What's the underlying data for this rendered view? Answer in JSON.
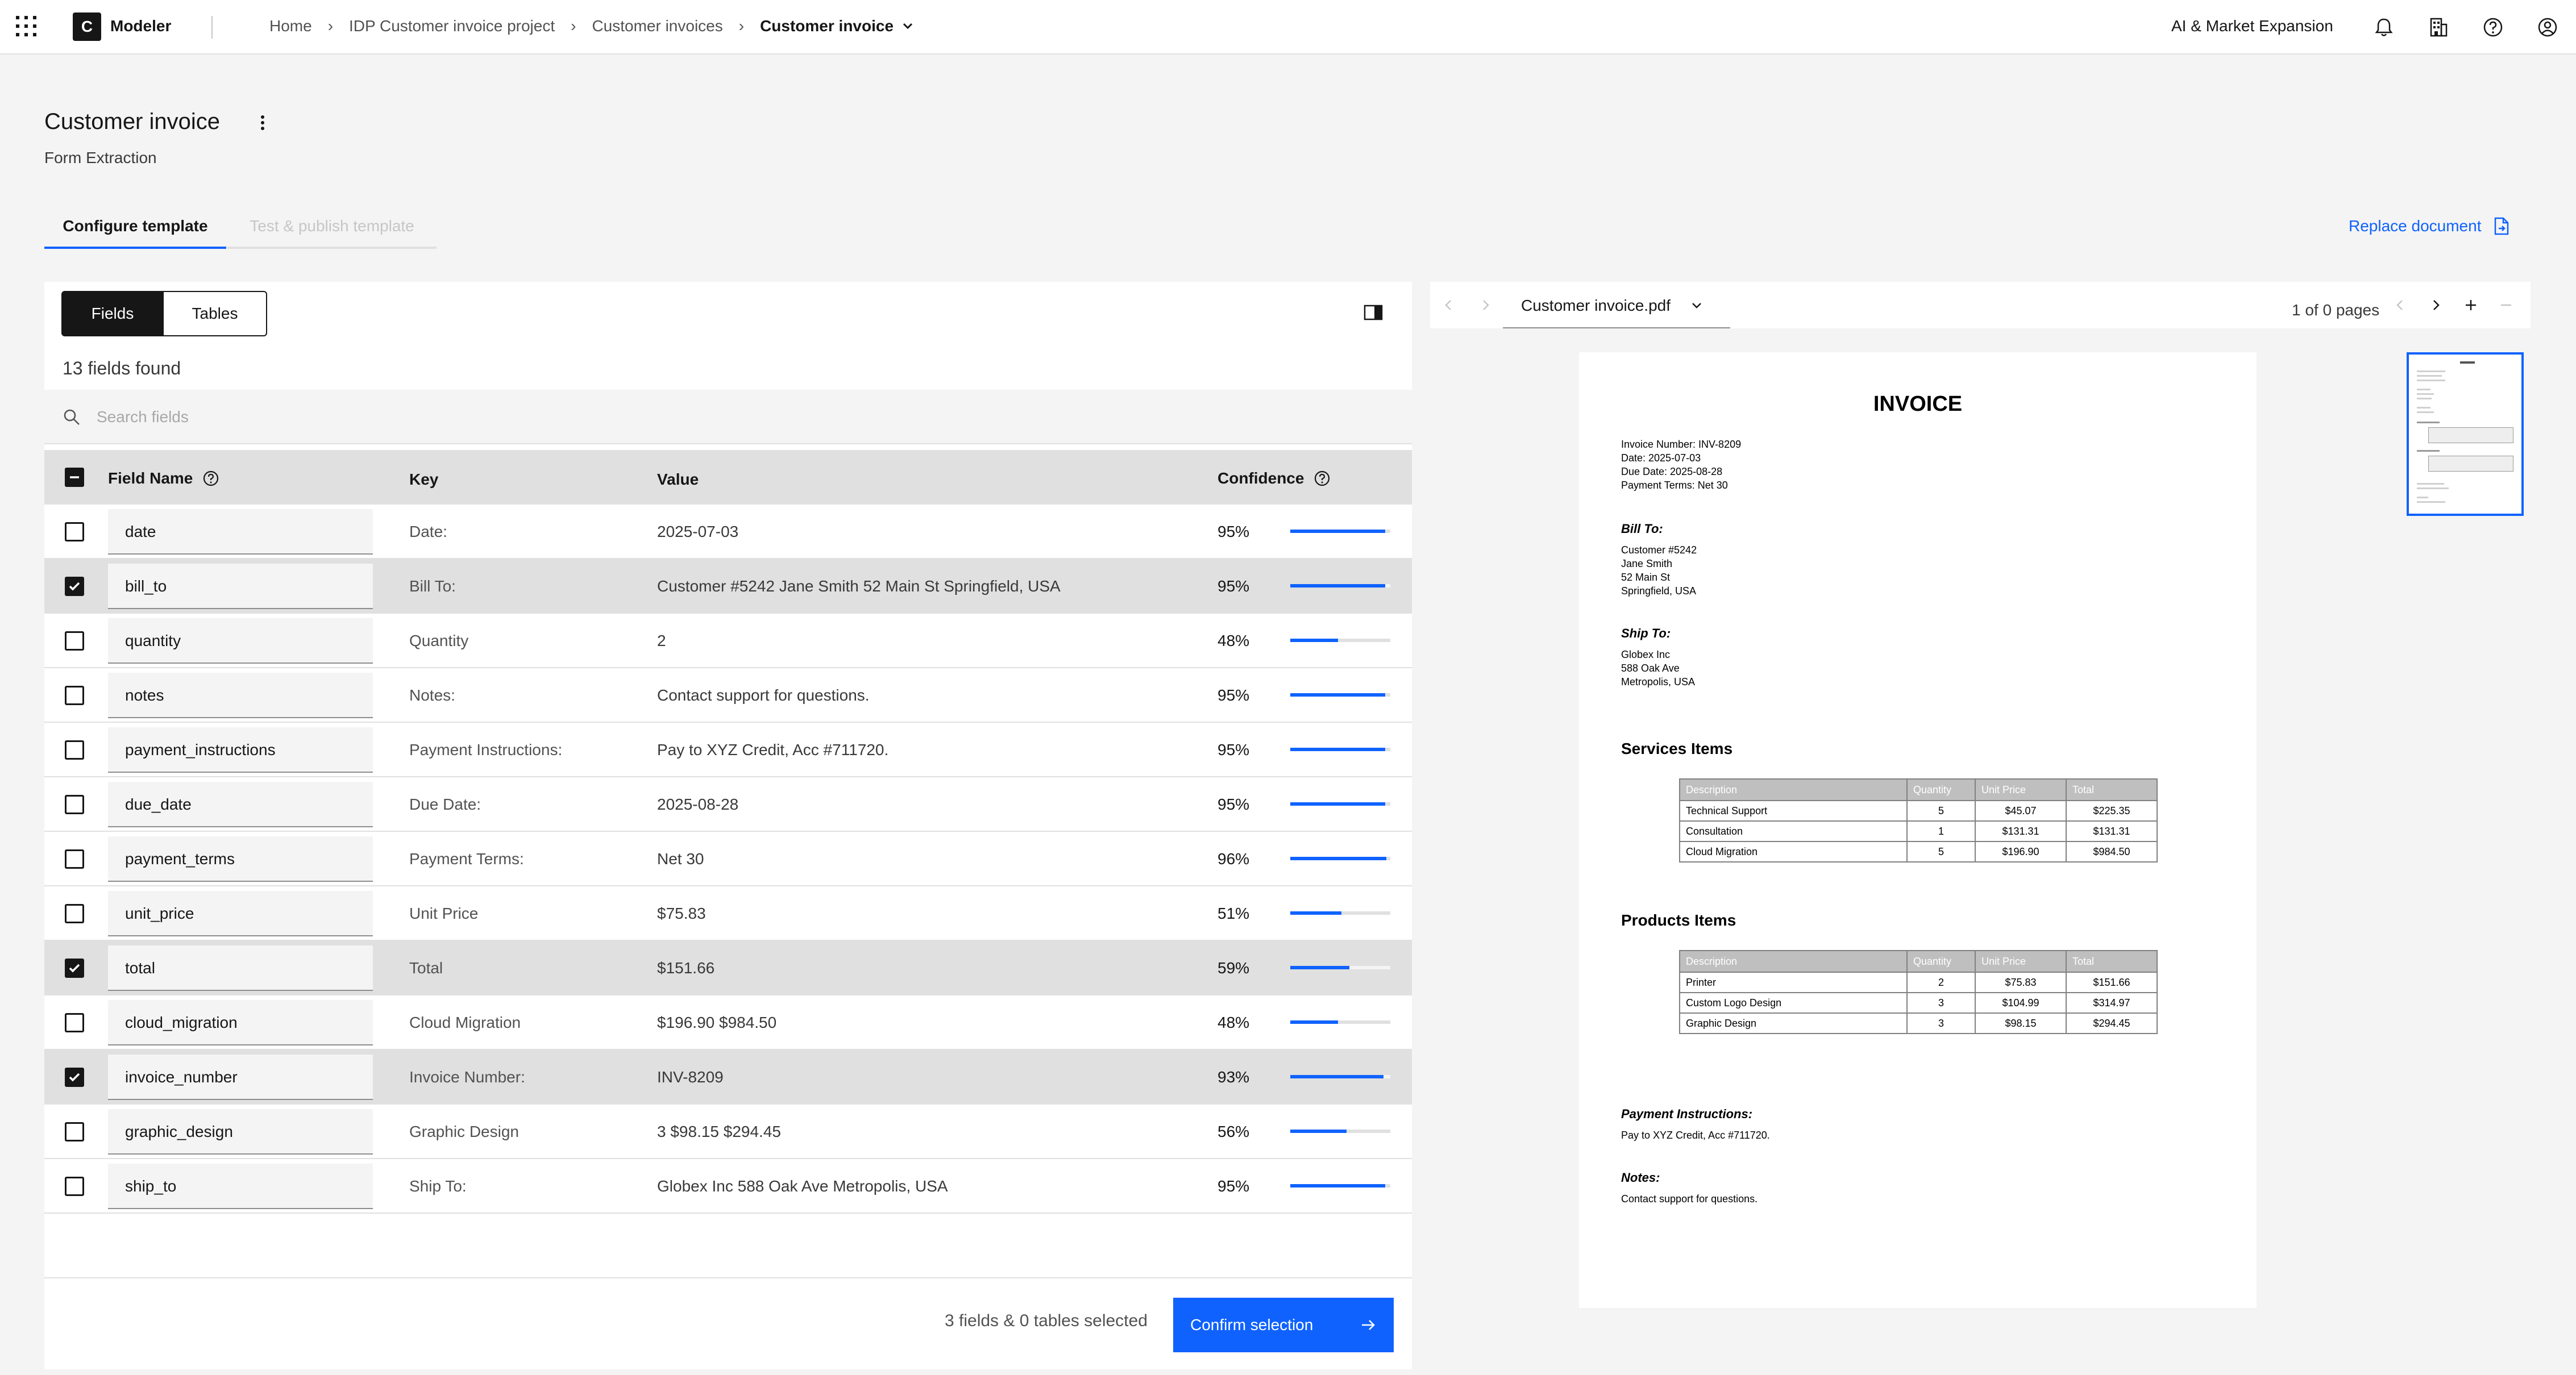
{
  "header": {
    "logo_letter": "C",
    "app_name": "Modeler",
    "breadcrumb": [
      "Home",
      "IDP Customer invoice project",
      "Customer invoices"
    ],
    "breadcrumb_current": "Customer invoice",
    "org_name": "AI & Market Expansion",
    "icons": [
      "app-switcher-icon",
      "notification-icon",
      "building-icon",
      "help-icon",
      "user-avatar-icon"
    ]
  },
  "page": {
    "title": "Customer invoice",
    "subtitle": "Form Extraction",
    "tabs": [
      "Configure template",
      "Test & publish template"
    ],
    "active_tab": 0,
    "replace_document": "Replace document"
  },
  "fields_panel": {
    "segments": [
      "Fields",
      "Tables"
    ],
    "active_segment": 0,
    "fields_found": "13 fields found",
    "search_placeholder": "Search fields",
    "columns": {
      "field_name": "Field Name",
      "key": "Key",
      "value": "Value",
      "confidence": "Confidence"
    },
    "rows": [
      {
        "name": "date",
        "key": "Date:",
        "value": "2025-07-03",
        "confidence": "95%",
        "conf_value": 0.95,
        "checked": false
      },
      {
        "name": "bill_to",
        "key": "Bill To:",
        "value": "Customer #5242 Jane Smith 52 Main St Springfield, USA",
        "confidence": "95%",
        "conf_value": 0.95,
        "checked": true
      },
      {
        "name": "quantity",
        "key": "Quantity",
        "value": "2",
        "confidence": "48%",
        "conf_value": 0.48,
        "checked": false
      },
      {
        "name": "notes",
        "key": "Notes:",
        "value": "Contact support for questions.",
        "confidence": "95%",
        "conf_value": 0.95,
        "checked": false
      },
      {
        "name": "payment_instructions",
        "key": "Payment Instructions:",
        "value": "Pay to XYZ Credit, Acc #711720.",
        "confidence": "95%",
        "conf_value": 0.95,
        "checked": false
      },
      {
        "name": "due_date",
        "key": "Due Date:",
        "value": "2025-08-28",
        "confidence": "95%",
        "conf_value": 0.95,
        "checked": false
      },
      {
        "name": "payment_terms",
        "key": "Payment Terms:",
        "value": "Net 30",
        "confidence": "96%",
        "conf_value": 0.96,
        "checked": false
      },
      {
        "name": "unit_price",
        "key": "Unit Price",
        "value": "$75.83",
        "confidence": "51%",
        "conf_value": 0.51,
        "checked": false
      },
      {
        "name": "total",
        "key": "Total",
        "value": "$151.66",
        "confidence": "59%",
        "conf_value": 0.59,
        "checked": true
      },
      {
        "name": "cloud_migration",
        "key": "Cloud Migration",
        "value": "$196.90 $984.50",
        "confidence": "48%",
        "conf_value": 0.48,
        "checked": false
      },
      {
        "name": "invoice_number",
        "key": "Invoice Number:",
        "value": "INV-8209",
        "confidence": "93%",
        "conf_value": 0.93,
        "checked": true
      },
      {
        "name": "graphic_design",
        "key": "Graphic Design",
        "value": "3 $98.15 $294.45",
        "confidence": "56%",
        "conf_value": 0.56,
        "checked": false
      },
      {
        "name": "ship_to",
        "key": "Ship To:",
        "value": "Globex Inc 588 Oak Ave Metropolis, USA",
        "confidence": "95%",
        "conf_value": 0.95,
        "checked": false
      }
    ],
    "selection_summary": "3 fields & 0 tables selected",
    "confirm_label": "Confirm selection"
  },
  "viewer": {
    "file_name": "Customer invoice.pdf",
    "page_count": "1 of 0 pages"
  },
  "document": {
    "title": "INVOICE",
    "meta": [
      "Invoice Number: INV-8209",
      "Date: 2025-07-03",
      "Due Date: 2025-08-28",
      "Payment Terms: Net 30"
    ],
    "bill_to_heading": "Bill To:",
    "bill_to": [
      "Customer #5242",
      "Jane Smith",
      "52 Main St",
      "Springfield, USA"
    ],
    "ship_to_heading": "Ship To:",
    "ship_to": [
      "Globex Inc",
      "588 Oak Ave",
      "Metropolis, USA"
    ],
    "services_heading": "Services Items",
    "products_heading": "Products Items",
    "table_headers": [
      "Description",
      "Quantity",
      "Unit Price",
      "Total"
    ],
    "services": [
      [
        "Technical Support",
        "5",
        "$45.07",
        "$225.35"
      ],
      [
        "Consultation",
        "1",
        "$131.31",
        "$131.31"
      ],
      [
        "Cloud Migration",
        "5",
        "$196.90",
        "$984.50"
      ]
    ],
    "products": [
      [
        "Printer",
        "2",
        "$75.83",
        "$151.66"
      ],
      [
        "Custom Logo Design",
        "3",
        "$104.99",
        "$314.97"
      ],
      [
        "Graphic Design",
        "3",
        "$98.15",
        "$294.45"
      ]
    ],
    "payment_heading": "Payment Instructions:",
    "payment_text": "Pay to XYZ Credit, Acc #711720.",
    "notes_heading": "Notes:",
    "notes_text": "Contact support for questions."
  },
  "colors": {
    "accent": "#0f62fe",
    "selected_row": "#e0e0e0",
    "text": "#161616"
  }
}
